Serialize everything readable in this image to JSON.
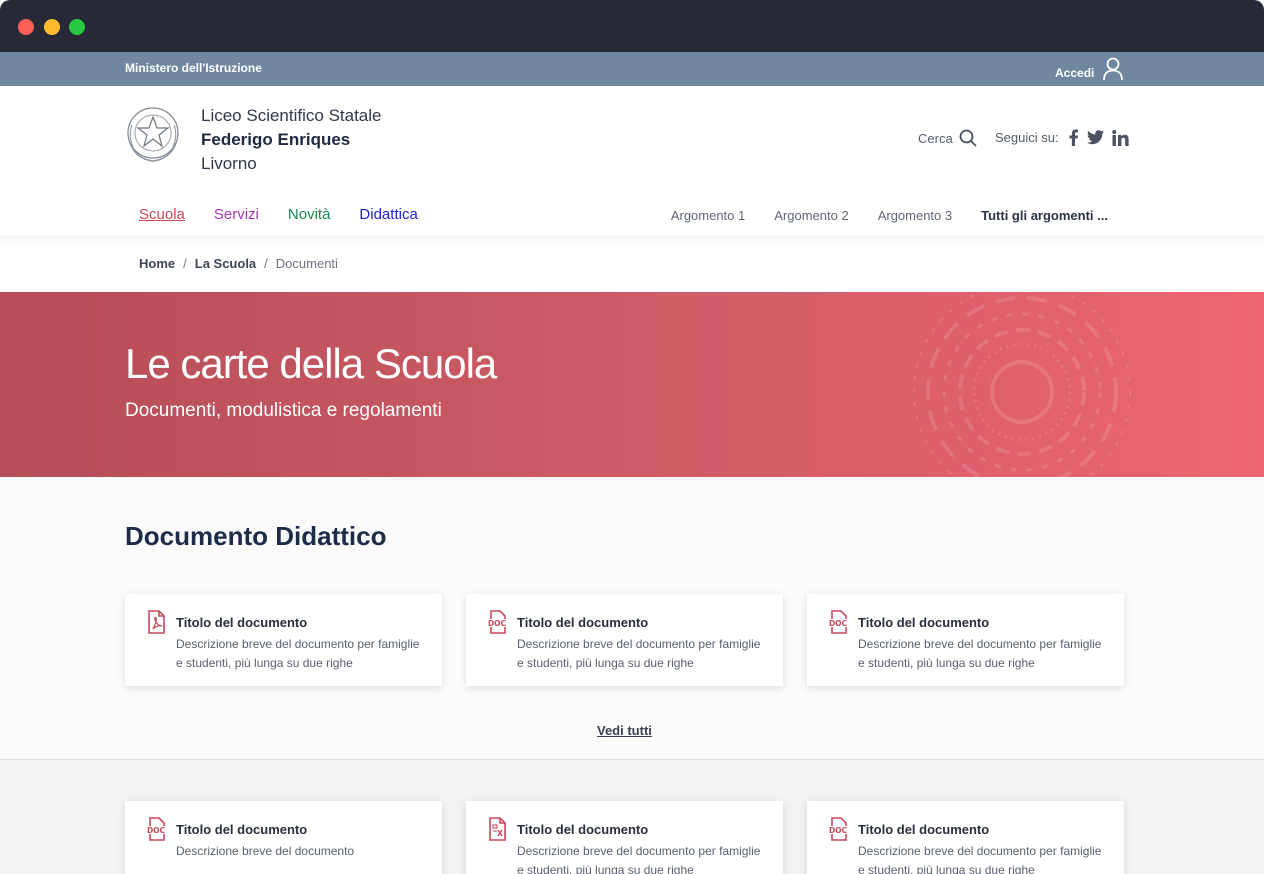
{
  "topbar": {
    "ministry": "Ministero dell'Istruzione",
    "login_label": "Accedi"
  },
  "header": {
    "school_line1": "Liceo Scientifico Statale",
    "school_line2": "Federigo Enriques",
    "school_line3": "Livorno",
    "search_label": "Cerca",
    "social_label": "Seguici su:"
  },
  "nav": {
    "items": [
      "Scuola",
      "Servizi",
      "Novità",
      "Didattica"
    ],
    "topics": [
      "Argomento 1",
      "Argomento 2",
      "Argomento 3",
      "Tutti gli argomenti ..."
    ]
  },
  "breadcrumb": {
    "home": "Home",
    "level1": "La Scuola",
    "current": "Documenti",
    "separator": "/"
  },
  "hero": {
    "title": "Le carte della Scuola",
    "subtitle": "Documenti, modulistica e regolamenti"
  },
  "section": {
    "title": "Documento Didattico",
    "see_all": "Vedi tutti",
    "cards_row1": [
      {
        "icon": "pdf-icon",
        "title": "Titolo del documento",
        "desc": "Descrizione breve del documento per famiglie e studenti, più lunga su due righe"
      },
      {
        "icon": "doc-icon",
        "title": "Titolo del documento",
        "desc": "Descrizione breve del documento per famiglie e studenti, più lunga su due righe"
      },
      {
        "icon": "doc-icon",
        "title": "Titolo del documento",
        "desc": "Descrizione breve del documento per famiglie e studenti, più lunga su due righe"
      }
    ],
    "cards_row2": [
      {
        "icon": "doc-icon",
        "title": "Titolo del documento",
        "desc": "Descrizione breve del documento"
      },
      {
        "icon": "spreadsheet-icon",
        "title": "Titolo del documento",
        "desc": "Descrizione breve del documento per famiglie e studenti, più lunga su due righe"
      },
      {
        "icon": "doc-icon",
        "title": "Titolo del documento",
        "desc": "Descrizione breve del documento per famiglie e studenti, più lunga su due righe"
      }
    ]
  },
  "colors": {
    "accent": "#c9485a",
    "topbar": "#6f889f",
    "hero_start": "#b64d58",
    "hero_end": "#ed6572"
  }
}
